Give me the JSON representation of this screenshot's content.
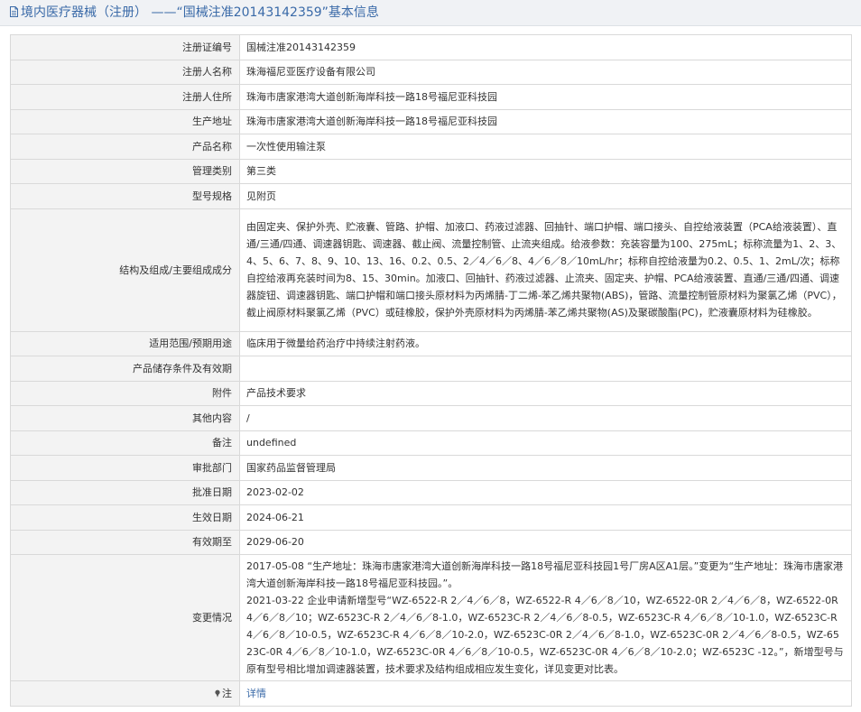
{
  "page": {
    "title": "境内医疗器械（注册） ——“国械注准20143142359”基本信息"
  },
  "colors": {
    "title_text": "#3a6aa8",
    "label_bg": "#f3f3f3",
    "border": "#d9d9d9",
    "link": "#3a6aa8"
  },
  "icons": {
    "title_icon": "document-icon",
    "note_icon": "pin-icon"
  },
  "rows": {
    "reg_no": {
      "label": "注册证编号",
      "value": "国械注准20143142359"
    },
    "registrant": {
      "label": "注册人名称",
      "value": "珠海福尼亚医疗设备有限公司"
    },
    "registrant_address": {
      "label": "注册人住所",
      "value": "珠海市唐家港湾大道创新海岸科技一路18号福尼亚科技园"
    },
    "production_address": {
      "label": "生产地址",
      "value": "珠海市唐家港湾大道创新海岸科技一路18号福尼亚科技园"
    },
    "product_name": {
      "label": "产品名称",
      "value": "一次性使用输注泵"
    },
    "management_class": {
      "label": "管理类别",
      "value": "第三类"
    },
    "model_spec": {
      "label": "型号规格",
      "value": "见附页"
    },
    "structure": {
      "label": "结构及组成/主要组成成分",
      "value": "由固定夹、保护外壳、贮液囊、管路、护帽、加液口、药液过滤器、回抽针、端口护帽、端口接头、自控给液装置（PCA给液装置）、直通/三通/四通、调速器钥匙、调速器、截止阀、流量控制管、止流夹组成。给液参数：充装容量为100、275mL；标称流量为1、2、3、4、5、6、7、8、9、10、13、16、0.2、0.5、2／4／6／8、4／6／8／10mL/hr；标称自控给液量为0.2、0.5、1、2mL/次；标称自控给液再充装时间为8、15、30min。加液口、回抽针、药液过滤器、止流夹、固定夹、护帽、PCA给液装置、直通/三通/四通、调速器旋钮、调速器钥匙、端口护帽和端口接头原材料为丙烯腈-丁二烯-苯乙烯共聚物(ABS)，管路、流量控制管原材料为聚氯乙烯（PVC），截止阀原材料聚氯乙烯（PVC）或硅橡胶，保护外壳原材料为丙烯腈-苯乙烯共聚物(AS)及聚碳酸酯(PC)，贮液囊原材料为硅橡胶。"
    },
    "scope": {
      "label": "适用范围/预期用途",
      "value": "临床用于微量给药治疗中持续注射药液。"
    },
    "storage": {
      "label": "产品储存条件及有效期",
      "value": ""
    },
    "attachment": {
      "label": "附件",
      "value": "产品技术要求"
    },
    "other": {
      "label": "其他内容",
      "value": "/"
    },
    "remark": {
      "label": "备注",
      "value": "undefined"
    },
    "approval_dept": {
      "label": "审批部门",
      "value": "国家药品监督管理局"
    },
    "approval_date": {
      "label": "批准日期",
      "value": "2023-02-02"
    },
    "effective_date": {
      "label": "生效日期",
      "value": "2024-06-21"
    },
    "expiry_date": {
      "label": "有效期至",
      "value": "2029-06-20"
    },
    "changes": {
      "label": "变更情况",
      "entries": [
        "2017-05-08 “生产地址：珠海市唐家港湾大道创新海岸科技一路18号福尼亚科技园1号厂房A区A1层。”变更为“生产地址：珠海市唐家港湾大道创新海岸科技一路18号福尼亚科技园。”。",
        "2021-03-22 企业申请新增型号“WZ-6522-R 2／4／6／8，WZ-6522-R 4／6／8／10，WZ-6522-0R 2／4／6／8，WZ-6522-0R 4／6／8／10；WZ-6523C-R 2／4／6／8-1.0，WZ-6523C-R 2／4／6／8-0.5，WZ-6523C-R 4／6／8／10-1.0，WZ-6523C-R 4／6／8／10-0.5，WZ-6523C-R 4／6／8／10-2.0，WZ-6523C-0R 2／4／6／8-1.0，WZ-6523C-0R 2／4／6／8-0.5，WZ-6523C-0R 4／6／8／10-1.0，WZ-6523C-0R 4／6／8／10-0.5，WZ-6523C-0R 4／6／8／10-2.0；WZ-6523C -12。”，新增型号与原有型号相比增加调速器装置，技术要求及结构组成相应发生变化，详见变更对比表。"
      ]
    },
    "note": {
      "label": "注",
      "link_text": "详情"
    }
  }
}
